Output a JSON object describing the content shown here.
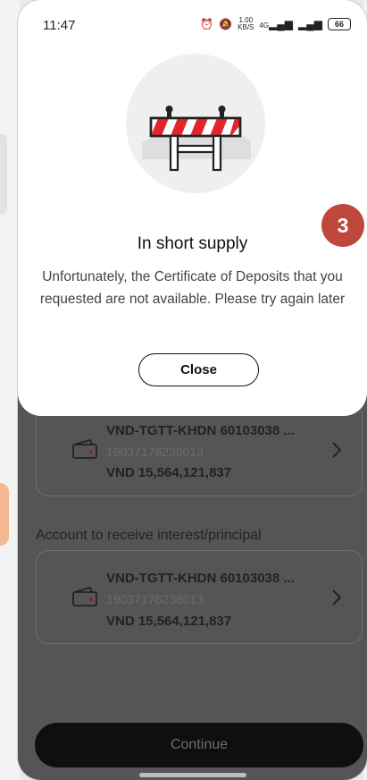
{
  "status_bar": {
    "time": "11:47",
    "speed_top": "1.00",
    "speed_bottom": "KB/S",
    "network": "4G",
    "battery": "66"
  },
  "modal": {
    "badge": "3",
    "title": "In short supply",
    "message": "Unfortunately, the Certificate of Deposits that you requested are not available. Please try again later",
    "close_label": "Close"
  },
  "source_account": {
    "name": "VND-TGTT-KHDN 60103038 ...",
    "number": "19037176238013",
    "balance": "VND 15,564,121,837"
  },
  "receive_section": {
    "label": "Account to receive interest/principal"
  },
  "receive_account": {
    "name": "VND-TGTT-KHDN 60103038 ...",
    "number": "19037176238013",
    "balance": "VND 15,564,121,837"
  },
  "footer": {
    "continue_label": "Continue"
  },
  "colors": {
    "badge": "#c0473b",
    "barrier_red": "#e0262b",
    "overlay": "#555555"
  }
}
